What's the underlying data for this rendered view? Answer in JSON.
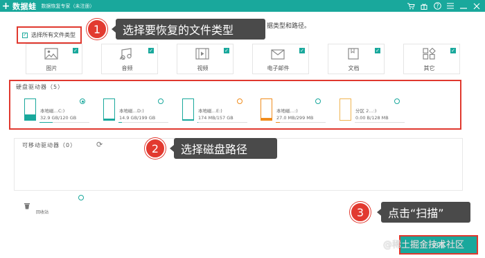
{
  "titlebar": {
    "logo_symbol": "+",
    "app_name": "数据蛙",
    "subtitle": "数据恢复专家（未注册）",
    "icons": [
      "cart-icon",
      "gift-icon",
      "help-icon",
      "menu-icon",
      "minimize-icon",
      "close-icon"
    ]
  },
  "hint_text": "据类型和路径。",
  "select_all": {
    "label": "选择所有文件类型",
    "checked": true
  },
  "file_types": [
    {
      "label": "图片",
      "icon": "image-icon",
      "checked": true
    },
    {
      "label": "音频",
      "icon": "music-icon",
      "checked": true
    },
    {
      "label": "视频",
      "icon": "video-icon",
      "checked": true
    },
    {
      "label": "电子邮件",
      "icon": "mail-icon",
      "checked": true
    },
    {
      "label": "文档",
      "icon": "document-icon",
      "checked": true
    },
    {
      "label": "其它",
      "icon": "other-icon",
      "checked": true
    }
  ],
  "hard_drives": {
    "title": "硬盘驱动器（5）",
    "drives": [
      {
        "name": "本地磁…C:)",
        "size": "32.9 GB/120 GB",
        "used_fraction": 0.27,
        "color": "#19a89c",
        "selected": true
      },
      {
        "name": "本地磁…D:)",
        "size": "14.9 GB/199 GB",
        "used_fraction": 0.07,
        "color": "#19a89c",
        "selected": false
      },
      {
        "name": "本地磁…E:)",
        "size": "174 MB/157 GB",
        "used_fraction": 0.01,
        "color": "#19a89c",
        "selected": false
      },
      {
        "name": "本地磁…:)",
        "size": "27.0 MB/299 MB",
        "used_fraction": 0.09,
        "color": "#f08c1c",
        "selected": false
      },
      {
        "name": "分区 2…:)",
        "size": "0.00  B/128 MB",
        "used_fraction": 0.0,
        "color": "#f0b450",
        "selected": false
      }
    ]
  },
  "removable": {
    "title": "可移动驱动器（0）"
  },
  "recycle_bin": {
    "label": "回收站"
  },
  "scan_button": {
    "label": "扫描"
  },
  "callouts": [
    {
      "number": "1",
      "text": "选择要恢复的文件类型"
    },
    {
      "number": "2",
      "text": "选择磁盘路径"
    },
    {
      "number": "3",
      "text": "点击“扫描”"
    }
  ],
  "watermark": "@稀土掘金技术社区",
  "colors": {
    "accent": "#19a89c",
    "highlight": "#e0382e",
    "callout_bg": "#4a4a4a",
    "badge": "#e23a30"
  }
}
